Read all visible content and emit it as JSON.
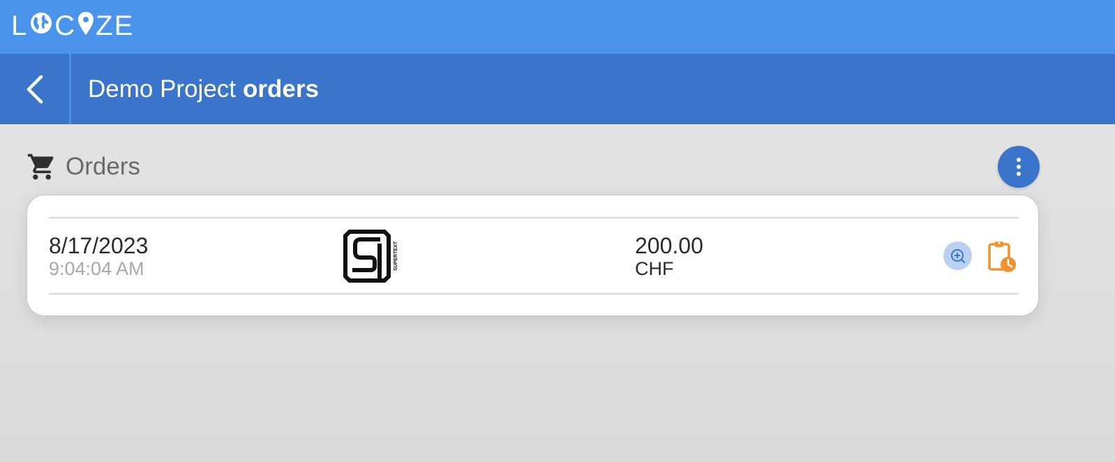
{
  "app": {
    "logo_text": [
      "L",
      "globe",
      "C",
      "pin",
      "ZE"
    ]
  },
  "header": {
    "title_prefix": "Demo Project",
    "title_bold": "orders"
  },
  "section": {
    "title": "Orders",
    "icon": "cart-icon"
  },
  "orders": [
    {
      "date": "8/17/2023",
      "time": "9:04:04 AM",
      "provider_logo": "supertext-logo",
      "provider_logo_text": "SUPERTEXT",
      "amount": "200.00",
      "currency": "CHF"
    }
  ],
  "colors": {
    "topbar": "#4a94ec",
    "subbar": "#3a75cb",
    "accent_orange": "#f0922e",
    "zoom_bg": "#b9d0f0"
  }
}
